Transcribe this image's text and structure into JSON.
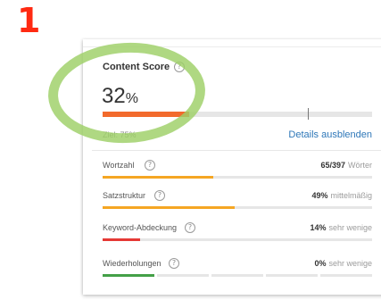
{
  "step_number": "1",
  "colors": {
    "step_number": "#ff2a12",
    "highlight": "#9dd067",
    "content_score_bar": "#f26a2c",
    "link": "#2e77b8",
    "orange_bar": "#f5a623",
    "red_bar": "#e53935",
    "green_bar": "#43a047"
  },
  "content_score": {
    "title": "Content Score",
    "help_icon": "question-circle-icon",
    "value": "32",
    "unit": "%",
    "progress_fraction": 0.32,
    "target_fraction": 0.76,
    "goal_text": "Ziel: 75%",
    "details_link": "Details ausblenden"
  },
  "metrics": [
    {
      "label": "Wortzahl",
      "value": "65/397",
      "desc": "Wörter",
      "fill_fraction": 0.41,
      "color": "#f5a623",
      "segmented": false
    },
    {
      "label": "Satzstruktur",
      "value": "49%",
      "desc": "mittelmäßig",
      "fill_fraction": 0.49,
      "color": "#f5a623",
      "segmented": false
    },
    {
      "label": "Keyword-Abdeckung",
      "value": "14%",
      "desc": "sehr wenige",
      "fill_fraction": 0.14,
      "color": "#e53935",
      "segmented": false
    },
    {
      "label": "Wiederholungen",
      "value": "0%",
      "desc": "sehr wenige",
      "segments_filled": 1,
      "segments_total": 5,
      "color": "#43a047",
      "segmented": true
    }
  ]
}
